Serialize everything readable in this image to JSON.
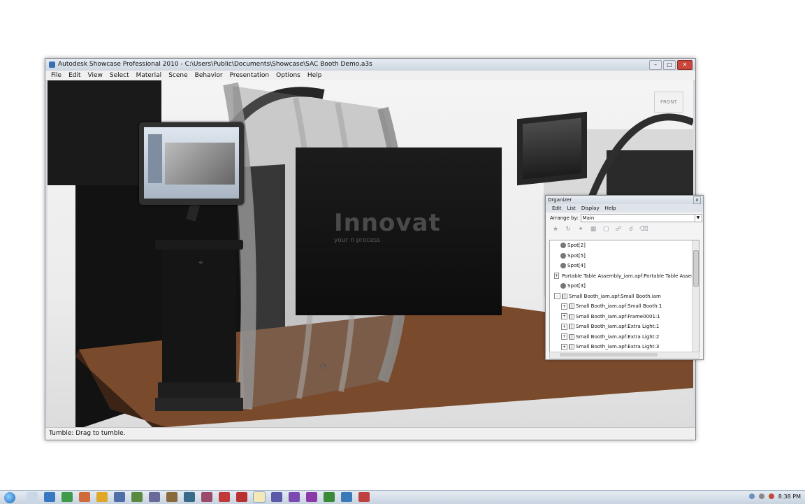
{
  "window": {
    "title": "Autodesk Showcase Professional 2010 - C:\\Users\\Public\\Documents\\Showcase\\SAC Booth Demo.a3s",
    "controls": {
      "minimize": "–",
      "maximize": "□",
      "close": "✕"
    }
  },
  "menu": {
    "items": [
      "File",
      "Edit",
      "View",
      "Select",
      "Material",
      "Scene",
      "Behavior",
      "Presentation",
      "Options",
      "Help"
    ]
  },
  "scene": {
    "booth_text": "Innovat",
    "booth_tagline": "your        n process",
    "view_cube": "FRONT",
    "cursor_glyphs": {
      "tumble": "⌖",
      "spin": "⟳"
    }
  },
  "status": {
    "text": "Tumble: Drag to tumble."
  },
  "organizer": {
    "title": "Organizer",
    "close": "x",
    "menu": [
      "Edit",
      "List",
      "Display",
      "Help"
    ],
    "arrange_label": "Arrange by:",
    "arrange_value": "Main",
    "toolbar_icons": [
      "wand-icon",
      "rotate-icon",
      "magic-icon",
      "group-icon",
      "ungroup-icon",
      "link-icon",
      "unlink-icon",
      "trash-icon"
    ],
    "items": [
      {
        "label": "Spot[2]",
        "level": 0,
        "expander": "",
        "icon": "light"
      },
      {
        "label": "Spot[5]",
        "level": 0,
        "expander": "",
        "icon": "light"
      },
      {
        "label": "Spot[4]",
        "level": 0,
        "expander": "",
        "icon": "light"
      },
      {
        "label": "Portable Table Assembly_iam.apf:Portable Table Assembly.iam (",
        "level": 0,
        "expander": "+",
        "icon": "model"
      },
      {
        "label": "Spot[3]",
        "level": 0,
        "expander": "",
        "icon": "light"
      },
      {
        "label": "Small Booth_iam.apf:Small Booth.iam",
        "level": 0,
        "expander": "–",
        "icon": "grid"
      },
      {
        "label": "Small Booth_iam.apf:Small Booth:1",
        "level": 1,
        "expander": "+",
        "icon": "grid"
      },
      {
        "label": "Small Booth_iam.apf:Frame0001:1",
        "level": 1,
        "expander": "+",
        "icon": "grid"
      },
      {
        "label": "Small Booth_iam.apf:Extra Light:1",
        "level": 1,
        "expander": "+",
        "icon": "grid"
      },
      {
        "label": "Small Booth_iam.apf:Extra Light:2",
        "level": 1,
        "expander": "+",
        "icon": "grid"
      },
      {
        "label": "Small Booth_iam.apf:Extra Light:3",
        "level": 1,
        "expander": "+",
        "icon": "grid"
      }
    ]
  },
  "taskbar": {
    "clock": "8:38 PM",
    "icons": [
      {
        "name": "explorer-icon",
        "color": "#c9d7e6",
        "active": false
      },
      {
        "name": "app-icon-1",
        "color": "#3a79c2",
        "active": false
      },
      {
        "name": "app-icon-2",
        "color": "#3f9a4a",
        "active": false
      },
      {
        "name": "app-icon-3",
        "color": "#d06a3a",
        "active": false
      },
      {
        "name": "app-icon-4",
        "color": "#e0a828",
        "active": false
      },
      {
        "name": "app-icon-5",
        "color": "#4f6fa8",
        "active": false
      },
      {
        "name": "app-icon-6",
        "color": "#5a8a40",
        "active": false
      },
      {
        "name": "app-icon-7",
        "color": "#6a6a9a",
        "active": false
      },
      {
        "name": "app-icon-8",
        "color": "#8a6a3a",
        "active": false
      },
      {
        "name": "app-icon-9",
        "color": "#3a6a8a",
        "active": false
      },
      {
        "name": "app-icon-10",
        "color": "#9a4a6a",
        "active": false
      },
      {
        "name": "app-icon-11",
        "color": "#c03a3a",
        "active": false
      },
      {
        "name": "app-icon-12",
        "color": "#b83030",
        "active": false
      },
      {
        "name": "showcase-taskbar-icon",
        "color": "#e8d080",
        "active": true
      },
      {
        "name": "app-icon-13",
        "color": "#5a5aa8",
        "active": false
      },
      {
        "name": "app-icon-14",
        "color": "#7a4ab0",
        "active": false
      },
      {
        "name": "app-icon-15",
        "color": "#8a3aa8",
        "active": false
      },
      {
        "name": "app-icon-16",
        "color": "#3a8a3a",
        "active": false
      },
      {
        "name": "app-icon-17",
        "color": "#3a7ab8",
        "active": false
      },
      {
        "name": "app-icon-18",
        "color": "#c04040",
        "active": false
      }
    ]
  },
  "colors": {
    "floor": "#7a4a2c",
    "booth_dark": "#111111",
    "arch": "#2e2e2e"
  }
}
